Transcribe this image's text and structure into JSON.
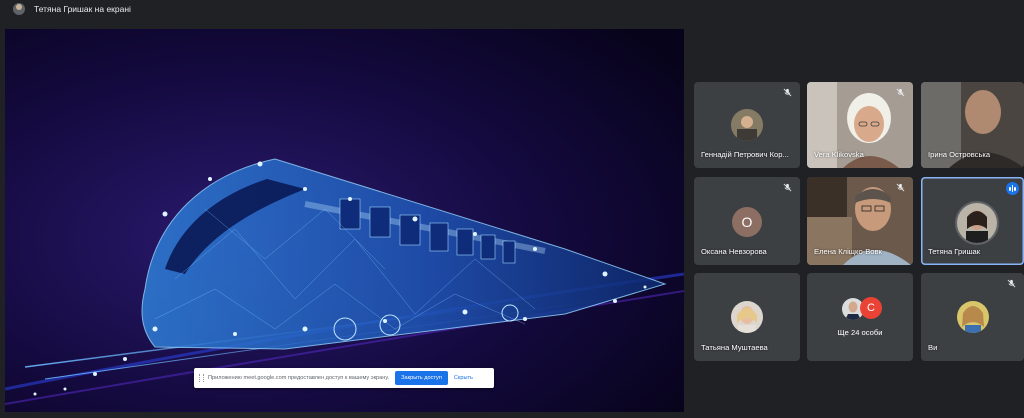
{
  "header": {
    "presenter_label": "Тетяна Гришак на екрані"
  },
  "share_bar": {
    "message": "Приложению meet.google.com предоставлен доступ к вашему экрану.",
    "stop_label": "Закрыть доступ",
    "hide_label": "Скрыть"
  },
  "participants": [
    {
      "name": "Геннадій Петрович Кор...",
      "muted": true,
      "kind": "avatar"
    },
    {
      "name": "Vera Klikovska",
      "muted": true,
      "kind": "video"
    },
    {
      "name": "Ірина Островська",
      "muted": false,
      "kind": "video"
    },
    {
      "name": "Оксана Невзорова",
      "muted": true,
      "kind": "letter",
      "initial": "О"
    },
    {
      "name": "Елена Кліщко-Вовк",
      "muted": true,
      "kind": "video"
    },
    {
      "name": "Тетяна Гришак",
      "muted": false,
      "kind": "avatar",
      "speaking": true
    },
    {
      "name": "Татьяна Муштаева",
      "muted": false,
      "kind": "avatar"
    },
    {
      "name": "Ще 24 особи",
      "kind": "more",
      "initial": "С"
    },
    {
      "name": "Ви",
      "muted": true,
      "kind": "avatar"
    }
  ],
  "colors": {
    "background": "#202124",
    "tile": "#3c4043",
    "accent": "#1a73e8",
    "letter_avatar": "#8d6e63",
    "second_avatar": "#ea4335"
  },
  "icons": {
    "mute": "mic-off-icon",
    "speaking": "audio-level-icon"
  }
}
